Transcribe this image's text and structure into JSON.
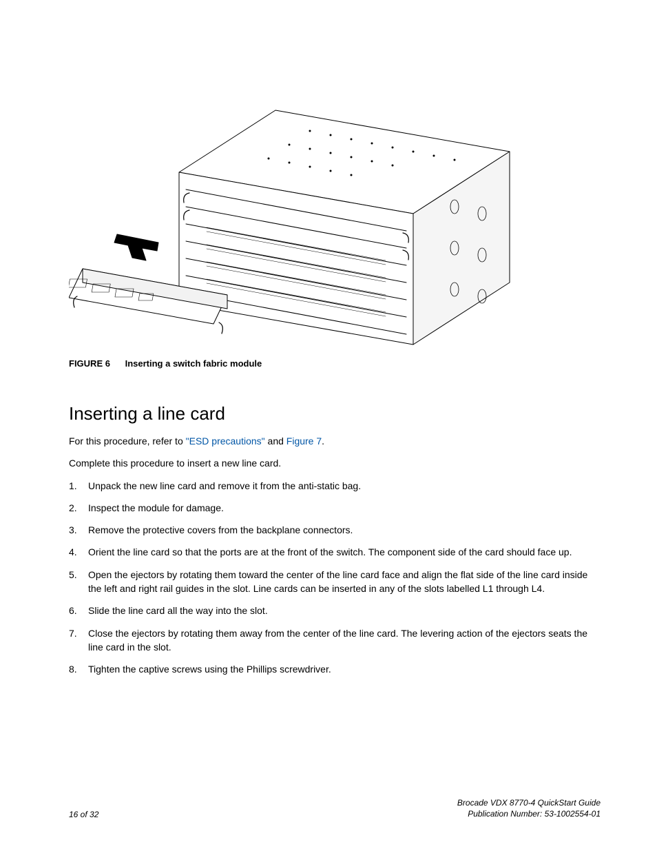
{
  "figure": {
    "label": "FIGURE 6",
    "title": "Inserting a switch fabric module"
  },
  "section": {
    "heading": "Inserting a line card",
    "intro_prefix": "For this procedure, refer to ",
    "intro_link1": "\"ESD precautions\"",
    "intro_mid": " and ",
    "intro_link2": "Figure 7",
    "intro_suffix": ".",
    "lead": "Complete this procedure to insert a new line card.",
    "steps": [
      "Unpack the new line card and remove it from the anti-static bag.",
      "Inspect the module for damage.",
      "Remove the protective covers from the backplane connectors.",
      "Orient the line card so that the ports are at the front of the switch. The component side of the card should face up.",
      "Open the ejectors by rotating them toward the center of the line card face and align the flat side of the line card inside the left and right rail guides in the slot. Line cards can be inserted in any of the slots labelled L1 through L4.",
      "Slide the line card all the way into the slot.",
      "Close the ejectors by rotating them away from the center of the line card. The levering action of the ejectors seats the line card in the slot.",
      "Tighten the captive screws using the Phillips screwdriver."
    ]
  },
  "footer": {
    "page": "16 of 32",
    "doc_title": "Brocade VDX 8770-4 QuickStart Guide",
    "pub_number": "Publication Number: 53-1002554-01"
  }
}
